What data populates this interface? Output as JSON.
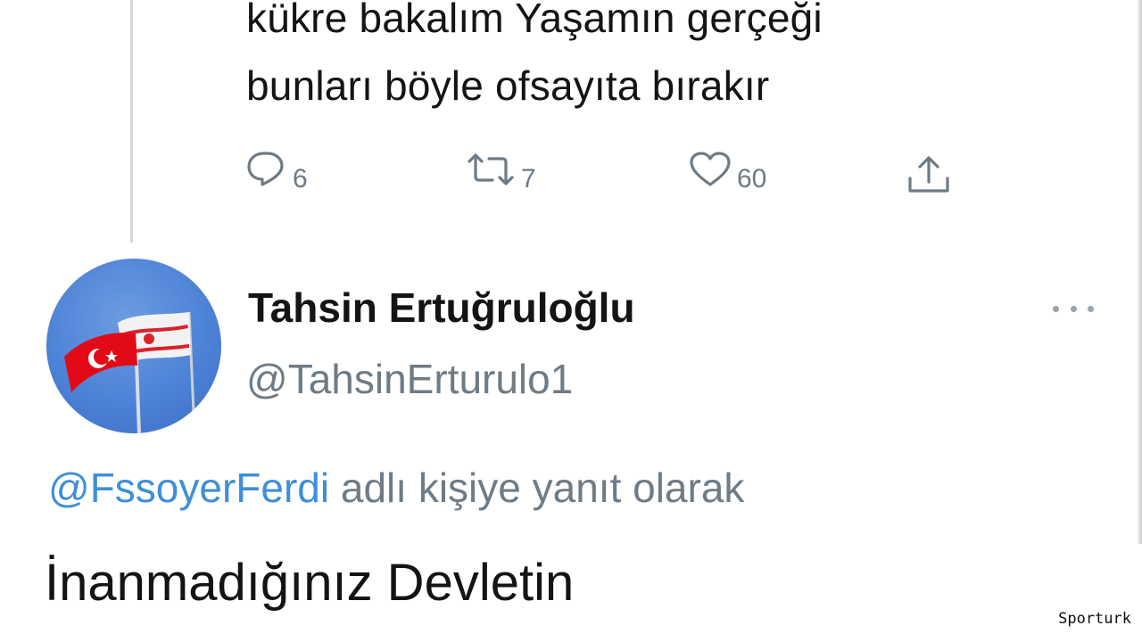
{
  "previous_tweet": {
    "lines": [
      "kükre bakalım Yaşamın gerçeği",
      "bunları böyle ofsayıta bırakır"
    ],
    "actions": {
      "reply_count": "6",
      "retweet_count": "7",
      "like_count": "60",
      "share_icon": "share-icon"
    }
  },
  "tweet": {
    "author_name": "Tahsin Ertuğruloğlu",
    "author_handle": "@TahsinErturulo1",
    "avatar_icon": "flag-photo-avatar",
    "more_icon": "more-dots-icon",
    "reply_mention": "@FssoyerFerdi",
    "reply_suffix": " adlı kişiye yanıt olarak",
    "text": "İnanmadığınız Devletin"
  },
  "colors": {
    "link_blue": "#3f8fd8",
    "muted_gray": "#6f7b85",
    "avatar_sky": "#4d82d6",
    "flag_red": "#e30a17"
  },
  "watermark": "Sporturk"
}
